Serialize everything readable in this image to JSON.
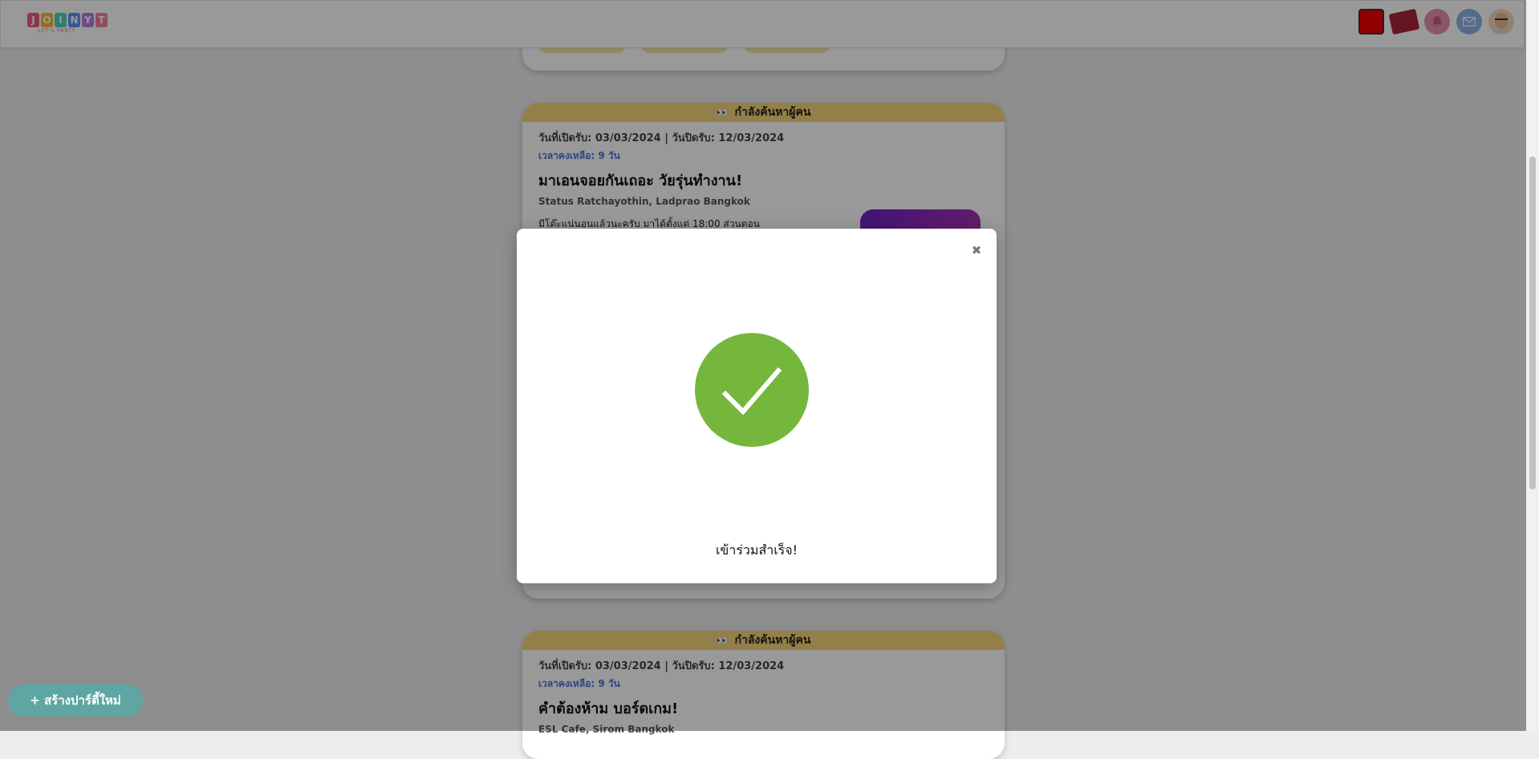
{
  "header": {
    "logo_letters": [
      {
        "char": "J",
        "color": "#f05a7e"
      },
      {
        "char": "O",
        "color": "#f7b731"
      },
      {
        "char": "I",
        "color": "#4cd3c2"
      },
      {
        "char": "N",
        "color": "#5f8ff3"
      },
      {
        "char": "Y",
        "color": "#b47ee5"
      },
      {
        "char": "T",
        "color": "#f37f9a"
      }
    ],
    "logo_subtitle": "LET'S PARTY",
    "icons": [
      "red-square-icon",
      "ticket-icon",
      "bell-icon",
      "mail-icon",
      "avatar"
    ]
  },
  "feed": {
    "cards": [
      {
        "status": "กำลังค้นหาผู้คน",
        "dates": "วันที่เปิดรับ: 03/03/2024 | วันปิดรับ: 12/03/2024",
        "remaining": "เวลาคงเหลือ: 9 วัน",
        "title": "มาเอนจอยกันเถอะ วัยรุ่นทำงาน!",
        "place": "Status Ratchayothin, Ladprao Bangkok",
        "description": "มีโต๊ะแน่นอนแล้วนะครับ มาได้ตั้งแต่ 18:00 ส่วนตอน"
      },
      {
        "status": "กำลังค้นหาผู้คน",
        "dates": "วันที่เปิดรับ: 03/03/2024 | วันปิดรับ: 12/03/2024",
        "remaining": "เวลาคงเหลือ: 9 วัน",
        "title": "คำต้องห้าม บอร์ดเกม!",
        "place": "ESL Cafe, Sirom Bangkok"
      }
    ]
  },
  "modal": {
    "close_symbol": "✖",
    "message": "เข้าร่วมสำเร็จ!",
    "success_color": "#74b73c"
  },
  "fab": {
    "label": "+ สร้างปาร์ตี้ใหม่"
  }
}
